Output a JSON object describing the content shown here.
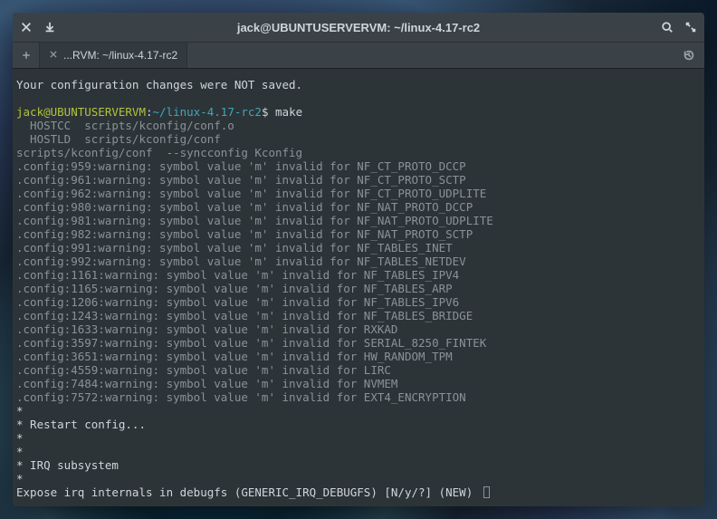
{
  "window": {
    "title": "jack@UBUNTUSERVERVM: ~/linux-4.17-rc2"
  },
  "tab": {
    "label": "...RVM: ~/linux-4.17-rc2"
  },
  "terminal": {
    "not_saved": "Your configuration changes were NOT saved.",
    "prompt": {
      "user_host": "jack@UBUNTUSERVERVM",
      "sep": ":",
      "cwd": "~/linux-4.17-rc2",
      "dollar": "$ "
    },
    "command": "make",
    "hostcc": "  HOSTCC  scripts/kconfig/conf.o",
    "hostld": "  HOSTLD  scripts/kconfig/conf",
    "syncconfig": "scripts/kconfig/conf  --syncconfig Kconfig",
    "warnings": [
      ".config:959:warning: symbol value 'm' invalid for NF_CT_PROTO_DCCP",
      ".config:961:warning: symbol value 'm' invalid for NF_CT_PROTO_SCTP",
      ".config:962:warning: symbol value 'm' invalid for NF_CT_PROTO_UDPLITE",
      ".config:980:warning: symbol value 'm' invalid for NF_NAT_PROTO_DCCP",
      ".config:981:warning: symbol value 'm' invalid for NF_NAT_PROTO_UDPLITE",
      ".config:982:warning: symbol value 'm' invalid for NF_NAT_PROTO_SCTP",
      ".config:991:warning: symbol value 'm' invalid for NF_TABLES_INET",
      ".config:992:warning: symbol value 'm' invalid for NF_TABLES_NETDEV",
      ".config:1161:warning: symbol value 'm' invalid for NF_TABLES_IPV4",
      ".config:1165:warning: symbol value 'm' invalid for NF_TABLES_ARP",
      ".config:1206:warning: symbol value 'm' invalid for NF_TABLES_IPV6",
      ".config:1243:warning: symbol value 'm' invalid for NF_TABLES_BRIDGE",
      ".config:1633:warning: symbol value 'm' invalid for RXKAD",
      ".config:3597:warning: symbol value 'm' invalid for SERIAL_8250_FINTEK",
      ".config:3651:warning: symbol value 'm' invalid for HW_RANDOM_TPM",
      ".config:4559:warning: symbol value 'm' invalid for LIRC",
      ".config:7484:warning: symbol value 'm' invalid for NVMEM",
      ".config:7572:warning: symbol value 'm' invalid for EXT4_ENCRYPTION"
    ],
    "restart": [
      "*",
      "* Restart config...",
      "*",
      "*",
      "* IRQ subsystem",
      "*"
    ],
    "prompt_line": "Expose irq internals in debugfs (GENERIC_IRQ_DEBUGFS) [N/y/?] (NEW) "
  }
}
